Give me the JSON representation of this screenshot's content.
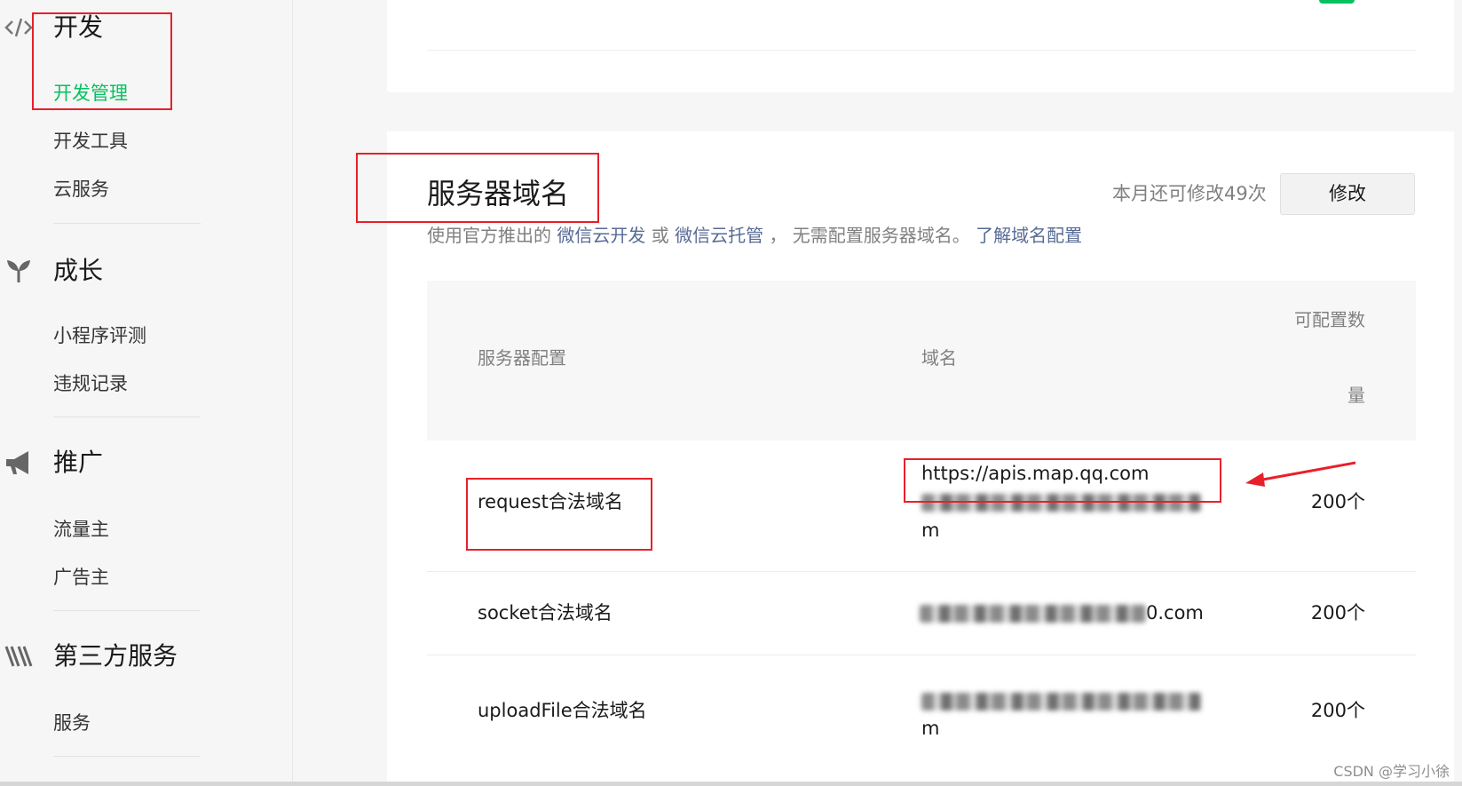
{
  "sidebar": {
    "sections": [
      {
        "title": "开发",
        "icon": "code-icon",
        "items": [
          "开发管理",
          "开发工具",
          "云服务"
        ]
      },
      {
        "title": "成长",
        "icon": "sprout-icon",
        "items": [
          "小程序评测",
          "违规记录"
        ]
      },
      {
        "title": "推广",
        "icon": "megaphone-icon",
        "items": [
          "流量主",
          "广告主"
        ]
      },
      {
        "title": "第三方服务",
        "icon": "third-party-icon",
        "items": [
          "服务"
        ]
      }
    ],
    "active_item": "开发管理",
    "active_color": "#07c160"
  },
  "server_domain": {
    "title": "服务器域名",
    "quota_text": "本月还可修改49次",
    "modify_label": "修改",
    "desc": {
      "prefix": "使用官方推出的",
      "link1": "微信云开发",
      "or": "或",
      "link2": "微信云托管",
      "middle": "， 无需配置服务器域名。",
      "link3": "了解域名配置"
    },
    "table": {
      "headers": {
        "config": "服务器配置",
        "domain": "域名",
        "count_line1": "可配置数",
        "count_line2": "量"
      },
      "rows": [
        {
          "config": "request合法域名",
          "domain": "https://apis.map.qq.com",
          "domain_tail": "m",
          "count": "200个"
        },
        {
          "config": "socket合法域名",
          "domain_tail": "0.com",
          "count": "200个"
        },
        {
          "config": "uploadFile合法域名",
          "domain_tail": "m",
          "count": "200个"
        }
      ]
    }
  },
  "watermark": "CSDN @学习小徐",
  "colors": {
    "link": "#576b95",
    "annotation_red": "#e8202a",
    "brand_green": "#07c160"
  }
}
